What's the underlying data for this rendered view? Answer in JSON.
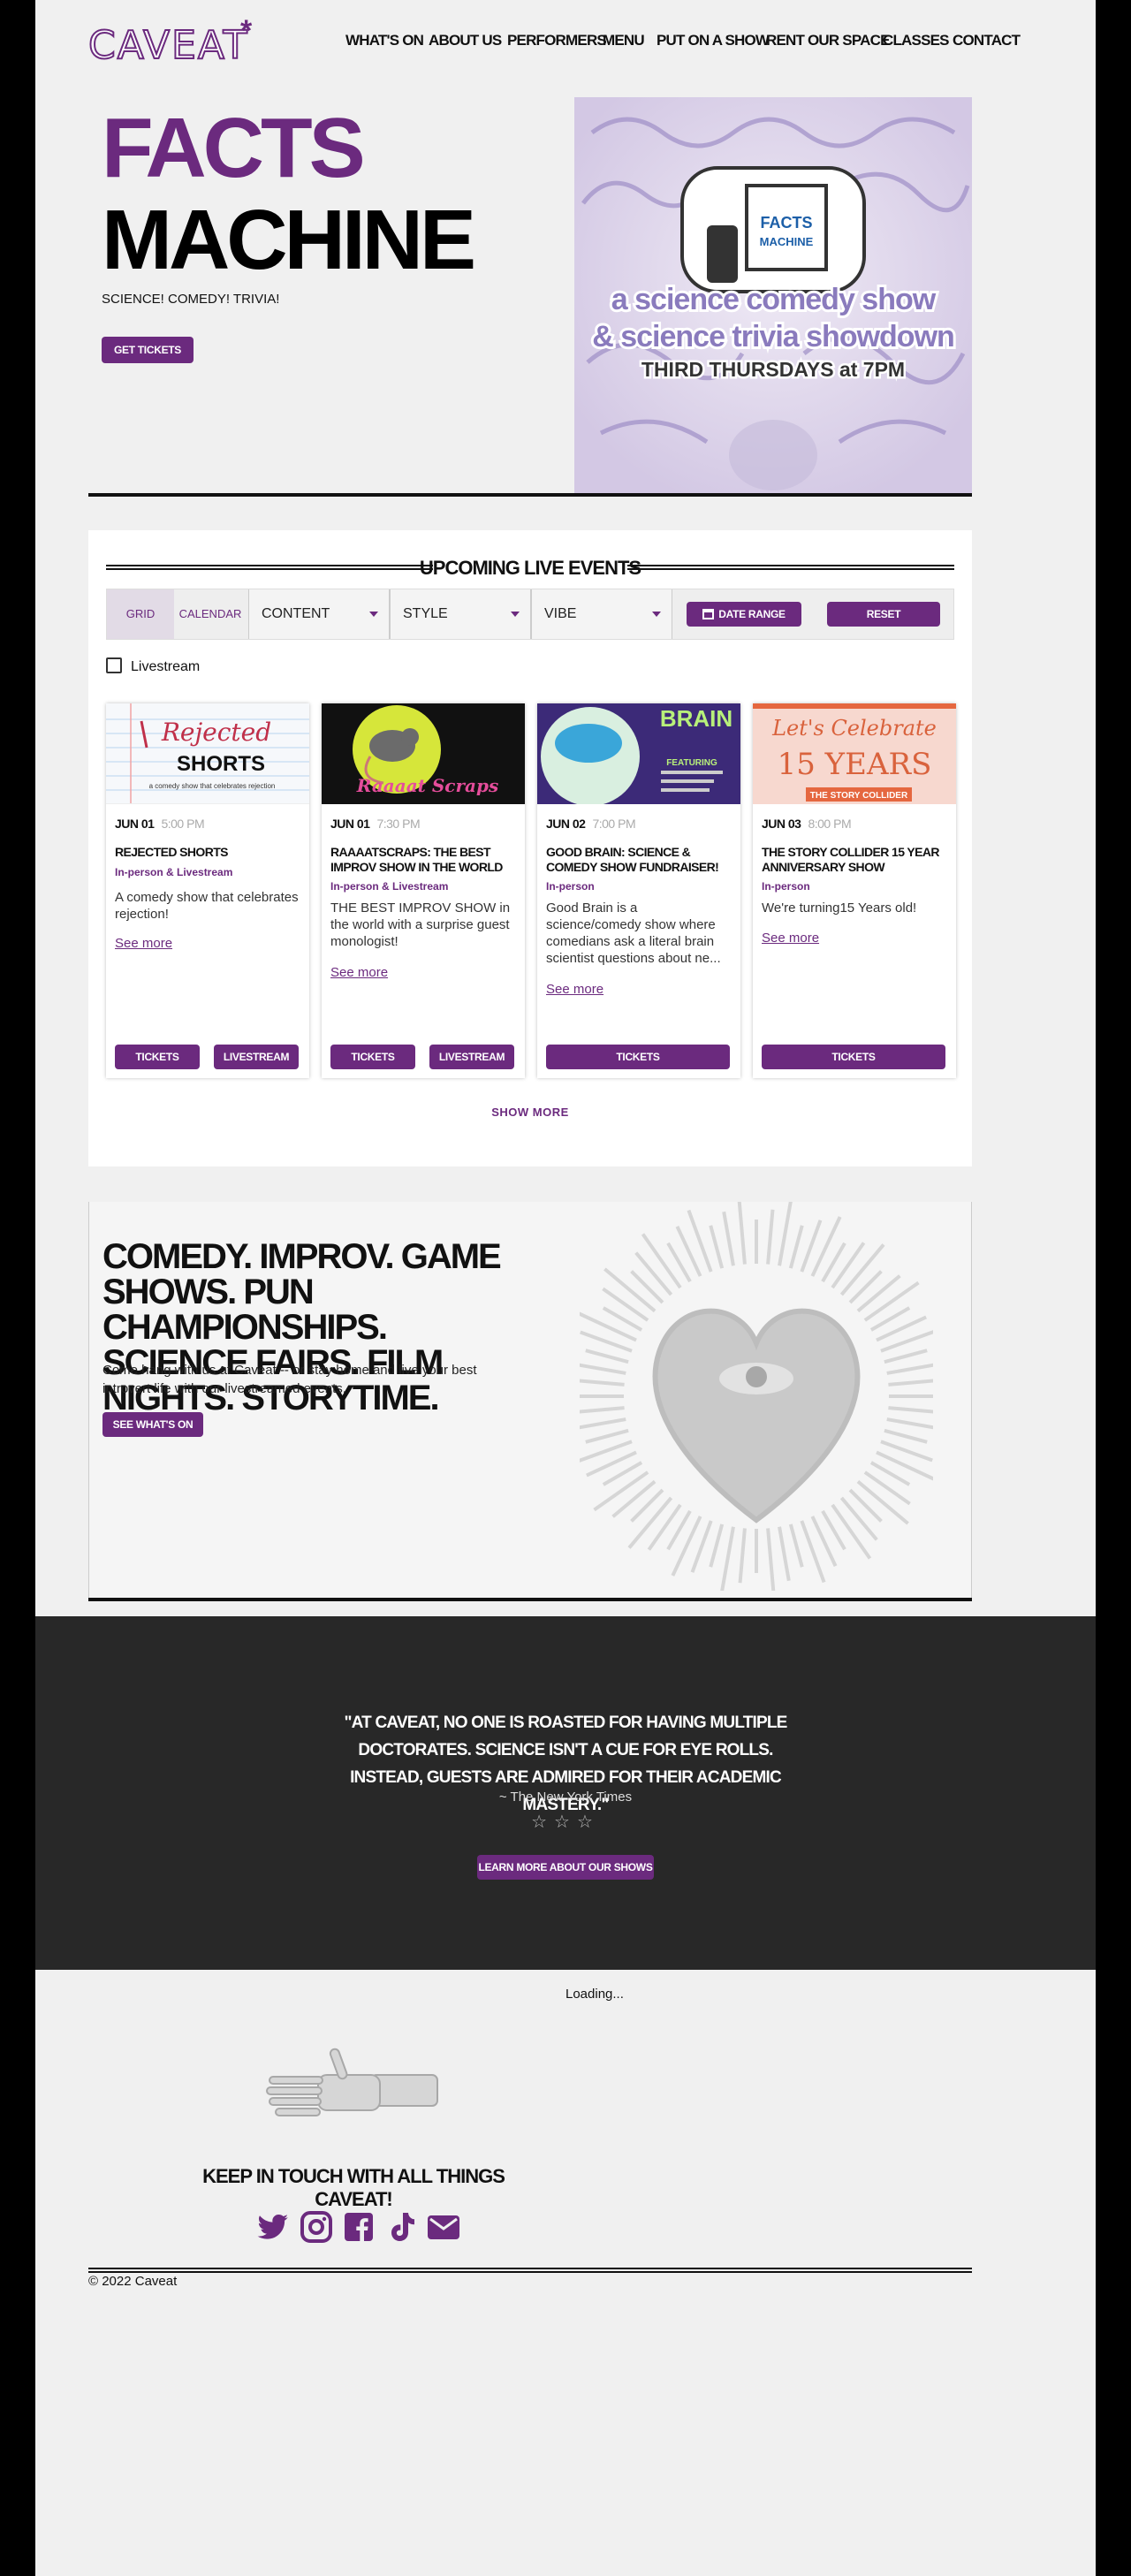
{
  "header": {
    "logo": "CAVEAT",
    "logo_star": "*",
    "nav": [
      "WHAT'S ON",
      "ABOUT US",
      "PERFORMERS",
      "MENU",
      "PUT ON A SHOW",
      "RENT OUR SPACE",
      "CLASSES",
      "CONTACT"
    ]
  },
  "hero": {
    "title_line1": "FACTS",
    "title_line2": "MACHINE",
    "subtitle": "SCIENCE! COMEDY! TRIVIA!",
    "button": "GET TICKETS",
    "poster": {
      "badge_top": "FACTS",
      "badge_bottom": "MACHINE",
      "line1": "a science comedy show",
      "line2": "& science trivia showdown",
      "line3": "THIRD THURSDAYS at 7PM"
    }
  },
  "events": {
    "heading": "UPCOMING LIVE EVENTS",
    "tabs": [
      "GRID",
      "CALENDAR"
    ],
    "selects": [
      "CONTENT",
      "STYLE",
      "VIBE"
    ],
    "date_range": "DATE RANGE",
    "reset": "RESET",
    "livestream_label": "Livestream",
    "show_more": "SHOW MORE",
    "cards": [
      {
        "date": "JUN 01",
        "time": "5:00 PM",
        "title": "REJECTED SHORTS",
        "type": "In-person & Livestream",
        "desc": "A comedy show that celebrates rejection!",
        "more": "See more",
        "buttons": [
          "TICKETS",
          "LIVESTREAM"
        ],
        "img_text1": "Rejected",
        "img_text2": "SHORTS",
        "img_text3": "a comedy show that celebrates rejection"
      },
      {
        "date": "JUN 01",
        "time": "7:30 PM",
        "title": "RAAAATSCRAPS: THE BEST IMPROV SHOW IN THE WORLD",
        "type": "In-person & Livestream",
        "desc": "THE BEST IMPROV SHOW in the world with a surprise guest monologist!",
        "more": "See more",
        "buttons": [
          "TICKETS",
          "LIVESTREAM"
        ],
        "img_text1": "Raaaat Scraps"
      },
      {
        "date": "JUN 02",
        "time": "7:00 PM",
        "title": "GOOD BRAIN: SCIENCE & COMEDY SHOW FUNDRAISER!",
        "type": "In-person",
        "desc": "Good Brain is a science/comedy show where comedians ask a literal brain scientist questions about ne...",
        "more": "See more",
        "buttons": [
          "TICKETS"
        ],
        "img_text1": "BRAIN",
        "img_text2": "FEATURING"
      },
      {
        "date": "JUN 03",
        "time": "8:00 PM",
        "title": "THE STORY COLLIDER 15 YEAR ANNIVERSARY SHOW",
        "type": "In-person",
        "desc": "We're turning15 Years old!",
        "more": "See more",
        "buttons": [
          "TICKETS"
        ],
        "img_text1": "Let's Celebrate",
        "img_text2": "15 YEARS",
        "img_text3": "THE STORY COLLIDER"
      }
    ]
  },
  "promo": {
    "heading": "COMEDY. IMPROV. GAME SHOWS. PUN CHAMPIONSHIPS. SCIENCE FAIRS. FILM NIGHTS. STORYTIME.",
    "text": "Come hang with us at Caveat -- or stay home and live your best introvert life with our livestreamed events.",
    "button": "SEE WHAT'S ON"
  },
  "quote": {
    "text": "\"AT CAVEAT, NO ONE IS ROASTED FOR HAVING MULTIPLE DOCTORATES. SCIENCE ISN'T A CUE FOR EYE ROLLS. INSTEAD, GUESTS ARE ADMIRED FOR THEIR ACADEMIC MASTERY.\"",
    "source": "~ The New York Times",
    "stars": "☆☆☆",
    "button": "LEARN MORE ABOUT OUR SHOWS"
  },
  "footer": {
    "loading": "Loading...",
    "keep_in_touch": "KEEP IN TOUCH WITH ALL THINGS CAVEAT!",
    "social": [
      "twitter-icon",
      "instagram-icon",
      "facebook-icon",
      "tiktok-icon",
      "email-icon"
    ],
    "copyright": "© 2022 Caveat"
  },
  "colors": {
    "accent": "#6b2a7e",
    "dark_band": "#282828",
    "page_bg": "#f0f0f0",
    "side_bg": "#000000"
  }
}
